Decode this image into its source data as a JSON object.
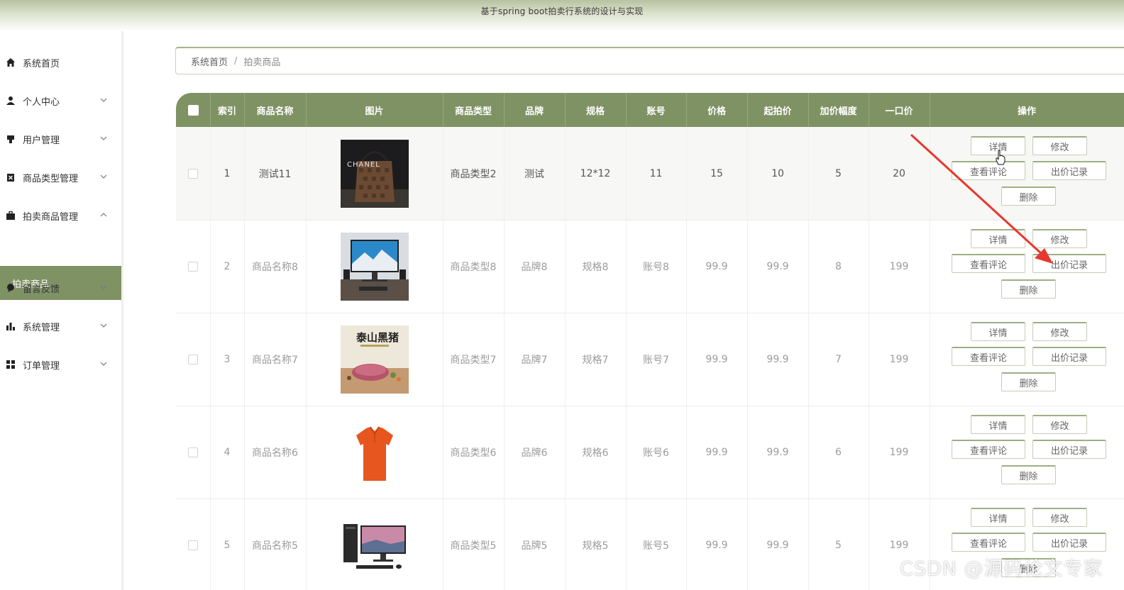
{
  "header": {
    "title": "基于spring boot拍卖行系统的设计与实现"
  },
  "sidebar": {
    "items": [
      {
        "label": "系统首页",
        "icon": "home-icon"
      },
      {
        "label": "个人中心",
        "icon": "user-icon"
      },
      {
        "label": "用户管理",
        "icon": "user-manage-icon"
      },
      {
        "label": "商品类型管理",
        "icon": "category-icon"
      },
      {
        "label": "拍卖商品管理",
        "icon": "briefcase-icon"
      },
      {
        "label": "留言反馈",
        "icon": "message-icon"
      },
      {
        "label": "系统管理",
        "icon": "chart-icon"
      },
      {
        "label": "订单管理",
        "icon": "grid-icon"
      }
    ],
    "active_sub": "拍卖商品"
  },
  "breadcrumb": {
    "home": "系统首页",
    "separator": "/",
    "current": "拍卖商品"
  },
  "table": {
    "headers": [
      "索引",
      "商品名称",
      "图片",
      "商品类型",
      "品牌",
      "规格",
      "账号",
      "价格",
      "起拍价",
      "加价幅度",
      "一口价",
      "操作"
    ],
    "rows": [
      {
        "index": "1",
        "name": "测试11",
        "image": "handbag-image",
        "type": "商品类型2",
        "brand": "测试",
        "spec": "12*12",
        "account": "11",
        "price": "15",
        "start": "10",
        "step": "5",
        "buyout": "20"
      },
      {
        "index": "2",
        "name": "商品名称8",
        "image": "monitor-image",
        "type": "商品类型8",
        "brand": "品牌8",
        "spec": "规格8",
        "account": "账号8",
        "price": "99.9",
        "start": "99.9",
        "step": "8",
        "buyout": "199"
      },
      {
        "index": "3",
        "name": "商品名称7",
        "image": "pork-image",
        "type": "商品类型7",
        "brand": "品牌7",
        "spec": "规格7",
        "account": "账号7",
        "price": "99.9",
        "start": "99.9",
        "step": "7",
        "buyout": "199"
      },
      {
        "index": "4",
        "name": "商品名称6",
        "image": "polo-shirt-image",
        "type": "商品类型6",
        "brand": "品牌6",
        "spec": "规格6",
        "account": "账号6",
        "price": "99.9",
        "start": "99.9",
        "step": "6",
        "buyout": "199"
      },
      {
        "index": "5",
        "name": "商品名称5",
        "image": "desktop-pc-image",
        "type": "商品类型5",
        "brand": "品牌5",
        "spec": "规格5",
        "account": "账号5",
        "price": "99.9",
        "start": "99.9",
        "step": "5",
        "buyout": "199"
      }
    ],
    "actions": {
      "detail": "详情",
      "edit": "修改",
      "review": "查看评论",
      "bids": "出价记录",
      "delete": "删除"
    }
  },
  "image_text": {
    "handbag_brand": "CHANEL",
    "pork_title": "泰山黑猪"
  },
  "watermark": "CSDN @源码论文专家",
  "colors": {
    "accent": "#7f9264",
    "arrow": "#e8372e"
  }
}
